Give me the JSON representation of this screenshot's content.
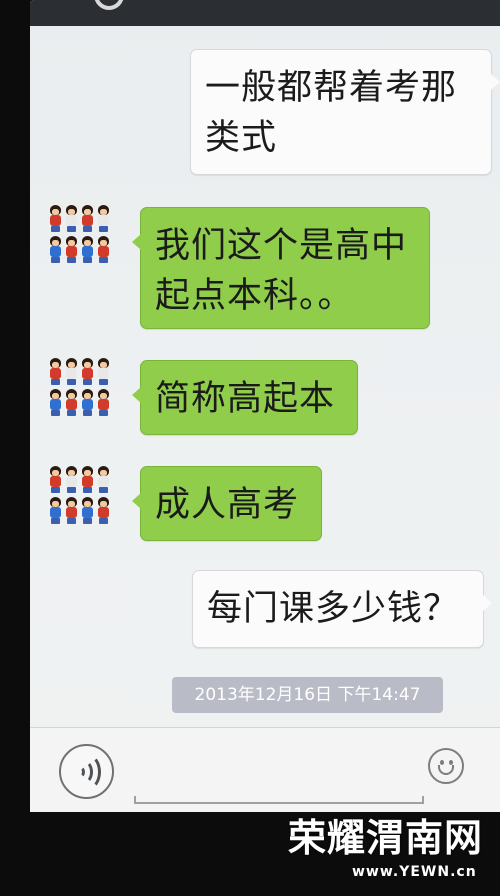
{
  "conversation": {
    "messages": [
      {
        "direction": "outgoing",
        "lines": [
          "一般都帮着考那",
          "类式"
        ]
      },
      {
        "direction": "incoming",
        "lines": [
          "我们这个是高中",
          "起点本科。。"
        ]
      },
      {
        "direction": "incoming",
        "lines": [
          "简称高起本"
        ]
      },
      {
        "direction": "incoming",
        "lines": [
          "成人高考"
        ]
      },
      {
        "direction": "outgoing",
        "lines": [
          "每门课多少钱？"
        ]
      }
    ],
    "timestamp": "2013年12月16日 下午14:47"
  },
  "input_bar": {
    "voice_icon": "voice-icon",
    "emoji_icon": "smiley-icon"
  },
  "watermark": {
    "title": "荣耀渭南网",
    "url": "www.YEWN.cn"
  },
  "colors": {
    "incoming_bubble": "#8fcd4a",
    "outgoing_bubble": "#fbfbfb",
    "timestamp_bg": "#b9bcc6"
  }
}
